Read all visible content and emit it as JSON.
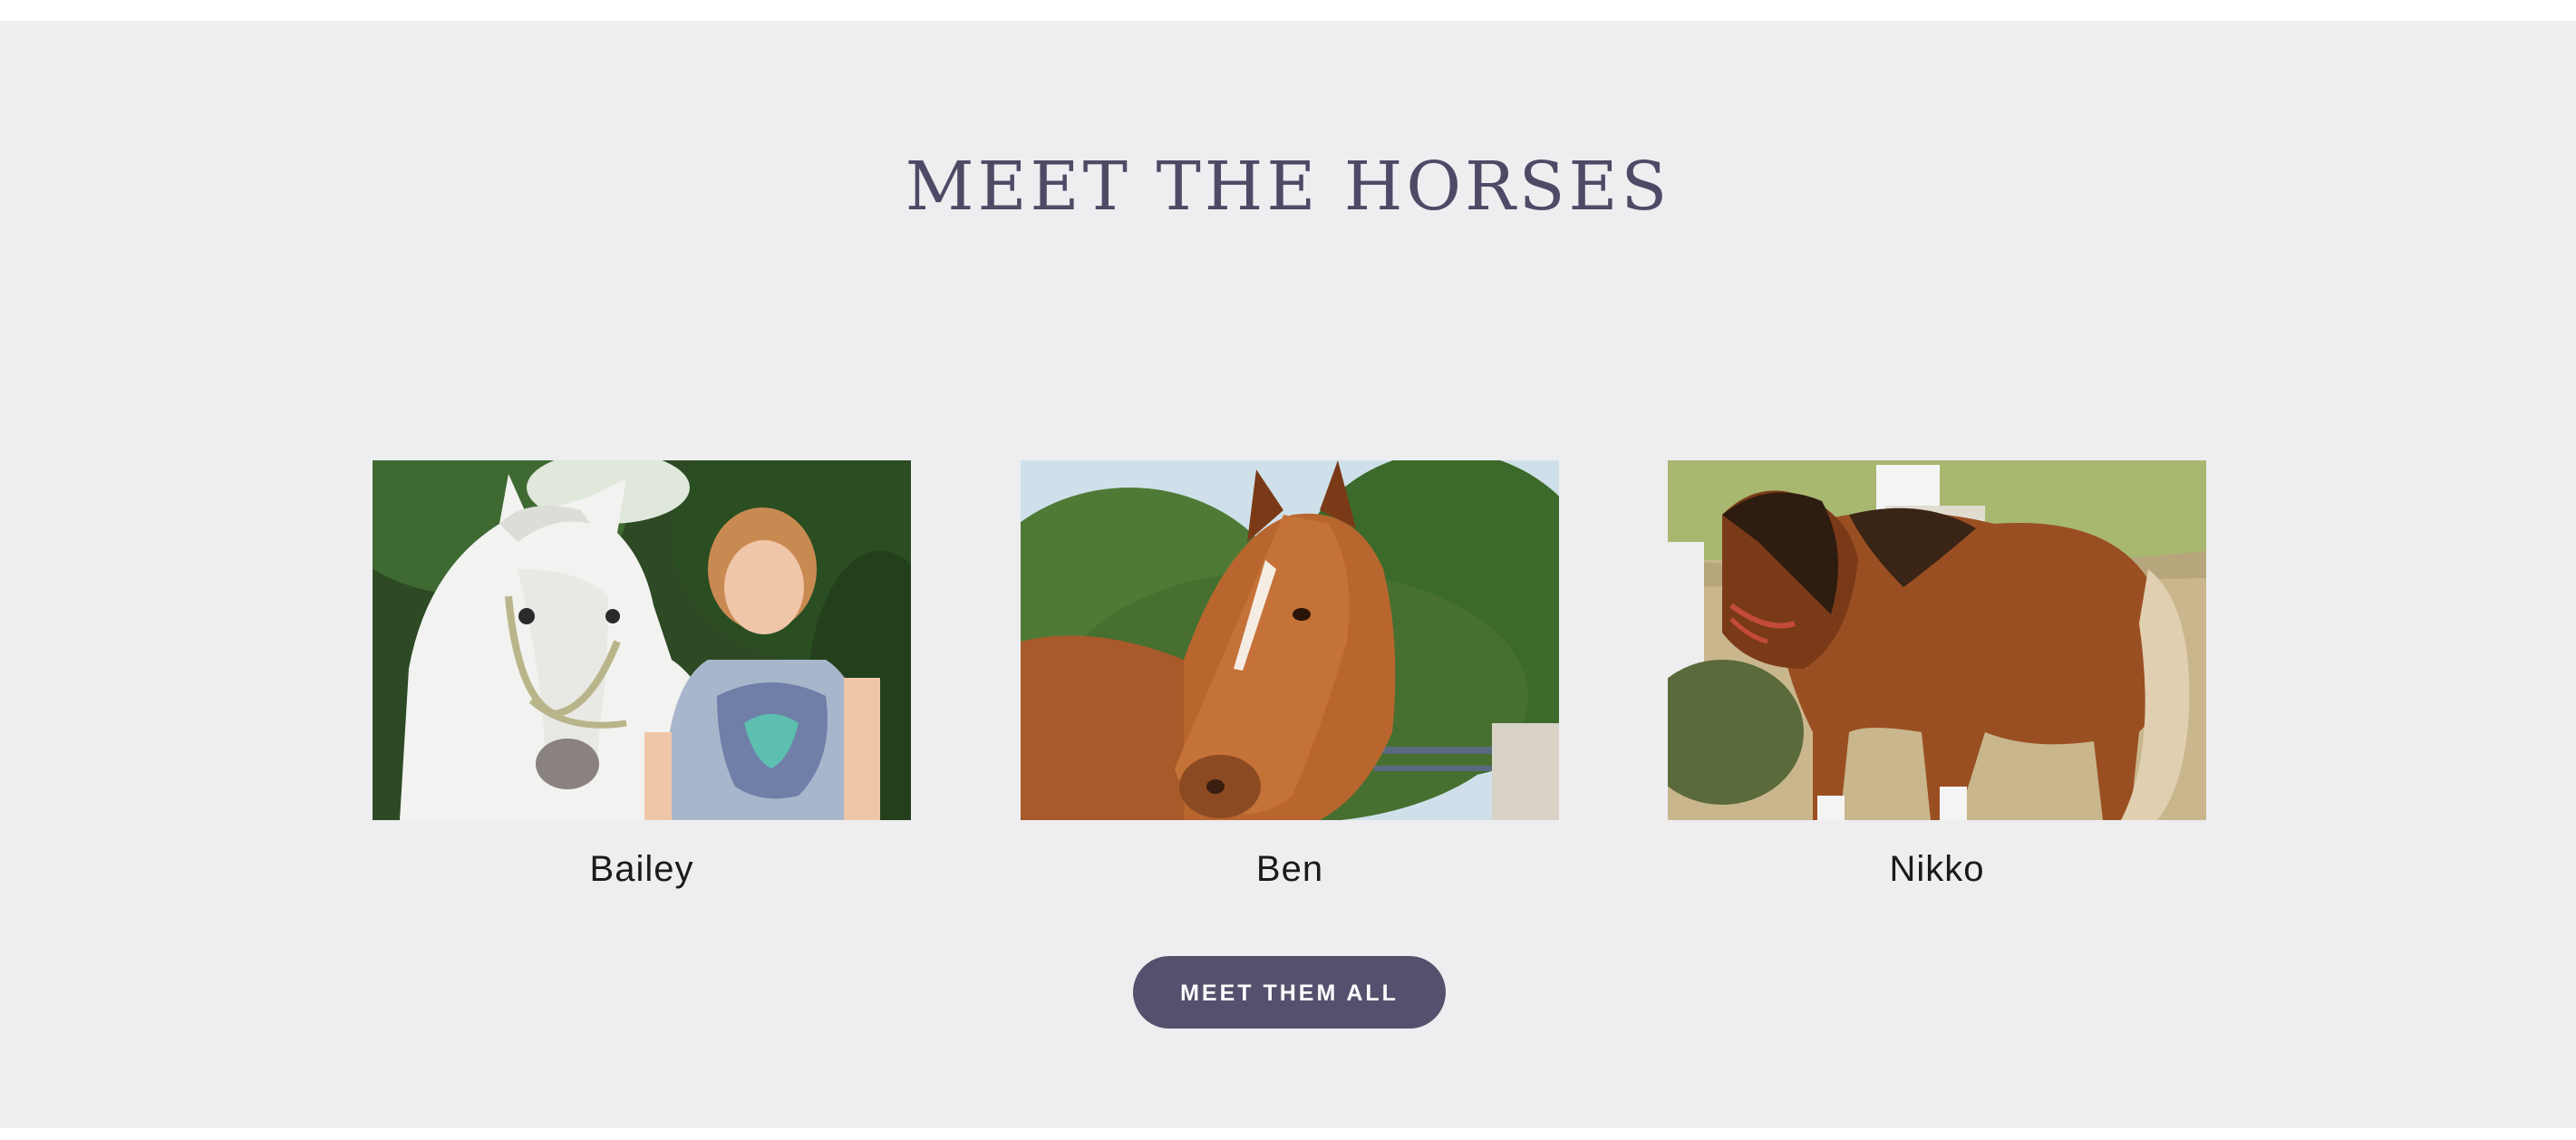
{
  "section": {
    "title": "MEET THE HORSES",
    "button_label": "MEET THEM ALL"
  },
  "horses": [
    {
      "name": "Bailey",
      "image": "white-horse-with-girl-photo"
    },
    {
      "name": "Ben",
      "image": "chestnut-horse-head-photo"
    },
    {
      "name": "Nikko",
      "image": "brown-pony-photo"
    }
  ],
  "colors": {
    "background": "#eeedf0",
    "title": "#4e4a66",
    "button": "#55506d",
    "button_text": "#ffffff"
  }
}
